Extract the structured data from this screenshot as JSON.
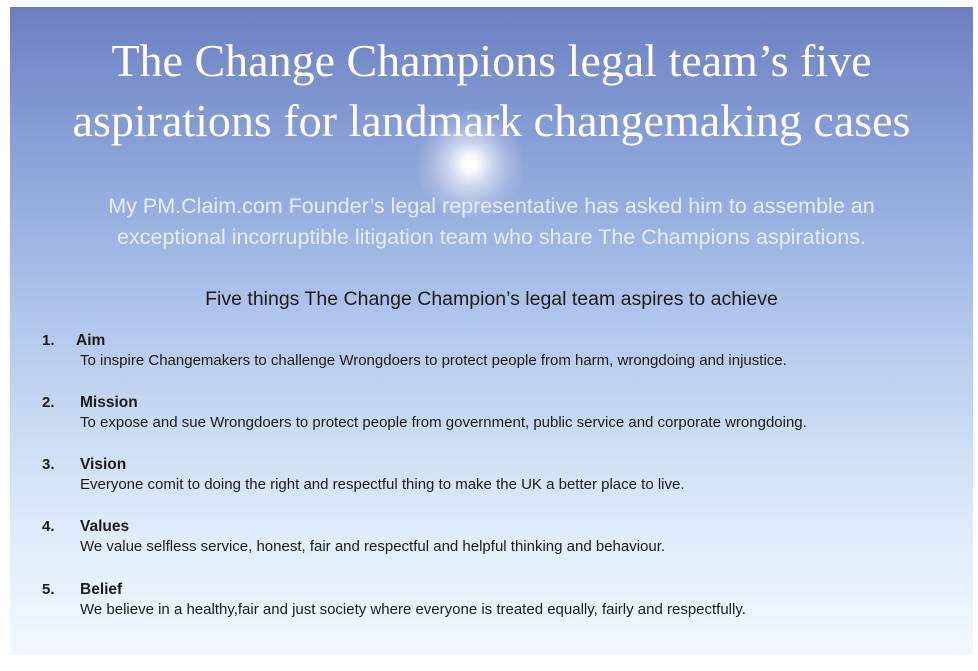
{
  "title": {
    "line1": "The Change Champions legal team’s five",
    "line2": "aspirations for landmark changemaking cases"
  },
  "subtitle": {
    "line1": "My PM.Claim.com Founder’s legal representative has asked him to assemble an",
    "line2": "exceptional incorruptible litigation team who share The Champions aspirations."
  },
  "section_heading": "Five things The Change Champion’s legal team aspires to achieve",
  "items": [
    {
      "number": "1.",
      "heading": "Aim",
      "text": "To inspire Changemakers to challenge Wrongdoers to protect people from harm, wrongdoing and injustice."
    },
    {
      "number": "2.",
      "heading": "Mission",
      "text": "To expose and sue Wrongdoers to protect people from government, public service and corporate wrongdoing."
    },
    {
      "number": "3.",
      "heading": "Vision",
      "text": "Everyone comit to doing the right and respectful thing to make the UK a better place to live."
    },
    {
      "number": "4.",
      "heading": "Values",
      "text": "We value selfless service, honest, fair and respectful and helpful thinking and behaviour."
    },
    {
      "number": "5.",
      "heading": "Belief",
      "text": "We believe in a healthy,fair and just society where everyone is treated equally, fairly and respectfully."
    }
  ],
  "colors": {
    "background_top": "#6b7fc0",
    "background_bottom": "#f3f8fe",
    "title_text": "#ffffff",
    "body_text": "#1c1c1c"
  }
}
